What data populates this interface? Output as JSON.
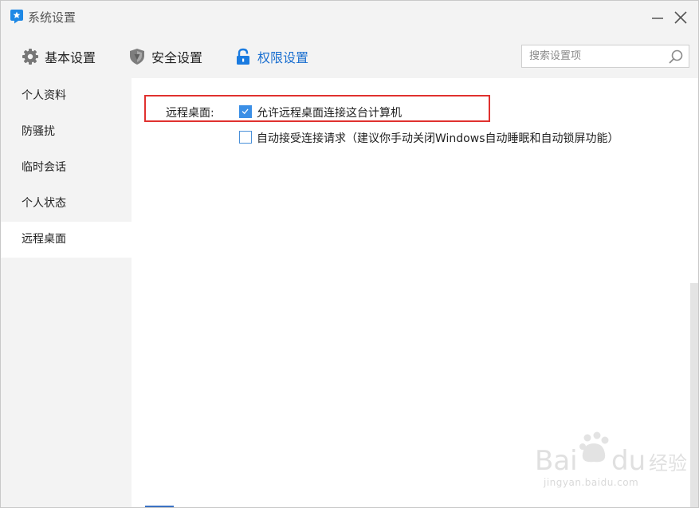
{
  "window": {
    "title": "系统设置"
  },
  "toolbar": {
    "tabs": [
      {
        "label": "基本设置",
        "icon": "gear-icon",
        "active": false
      },
      {
        "label": "安全设置",
        "icon": "shield-icon",
        "active": false
      },
      {
        "label": "权限设置",
        "icon": "lock-icon",
        "active": true
      }
    ],
    "search": {
      "placeholder": "搜索设置项",
      "value": ""
    }
  },
  "sidebar": {
    "items": [
      {
        "label": "个人资料",
        "active": false
      },
      {
        "label": "防骚扰",
        "active": false
      },
      {
        "label": "临时会话",
        "active": false
      },
      {
        "label": "个人状态",
        "active": false
      },
      {
        "label": "远程桌面",
        "active": true
      }
    ]
  },
  "content": {
    "remote_desktop": {
      "label": "远程桌面:",
      "options": [
        {
          "text": "允许远程桌面连接这台计算机",
          "checked": true
        },
        {
          "text": "自动接受连接请求（建议你手动关闭Windows自动睡眠和自动锁屏功能）",
          "checked": false
        }
      ]
    }
  },
  "watermark": {
    "logo_text": "Bai du 经验",
    "url": "jingyan.baidu.com"
  },
  "colors": {
    "accent": "#1a6fd0",
    "checkbox": "#3b8fe6",
    "highlight": "#e0312f",
    "chrome": "#f3f3f3"
  }
}
